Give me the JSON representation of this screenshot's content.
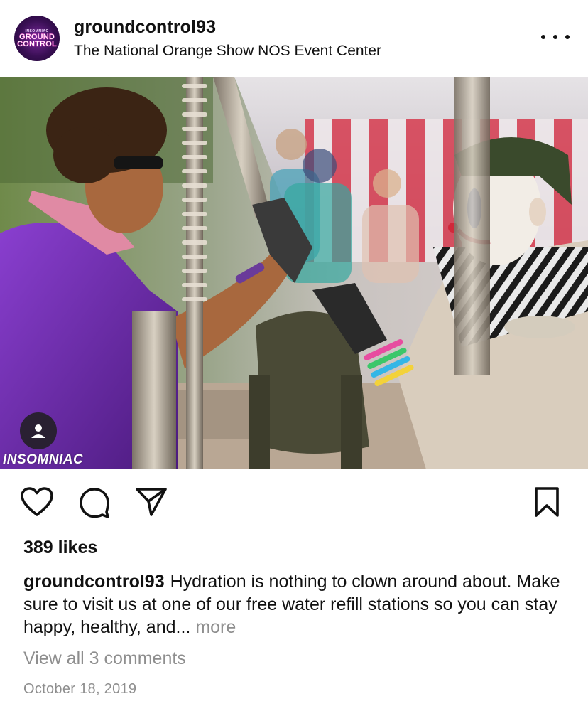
{
  "post": {
    "username": "groundcontrol93",
    "location": "The National Orange Show NOS Event Center",
    "avatar": {
      "small_text": "INSOMNIAC",
      "logo_line1": "GROUND",
      "logo_line2": "CONTROL"
    },
    "photo": {
      "watermark": "INSOMNIAC"
    },
    "likes": "389 likes",
    "caption": {
      "username": "groundcontrol93",
      "text": "Hydration is nothing to clown around about. Make sure to visit us at one of our free water refill stations so you can stay happy, healthy, and...",
      "more": "more"
    },
    "view_comments": "View all 3 comments",
    "date": "October 18, 2019"
  },
  "icons": {
    "more": "more-options-icon",
    "like": "heart-icon",
    "comment": "comment-icon",
    "share": "share-icon",
    "save": "bookmark-icon",
    "tag": "user-tag-icon"
  }
}
